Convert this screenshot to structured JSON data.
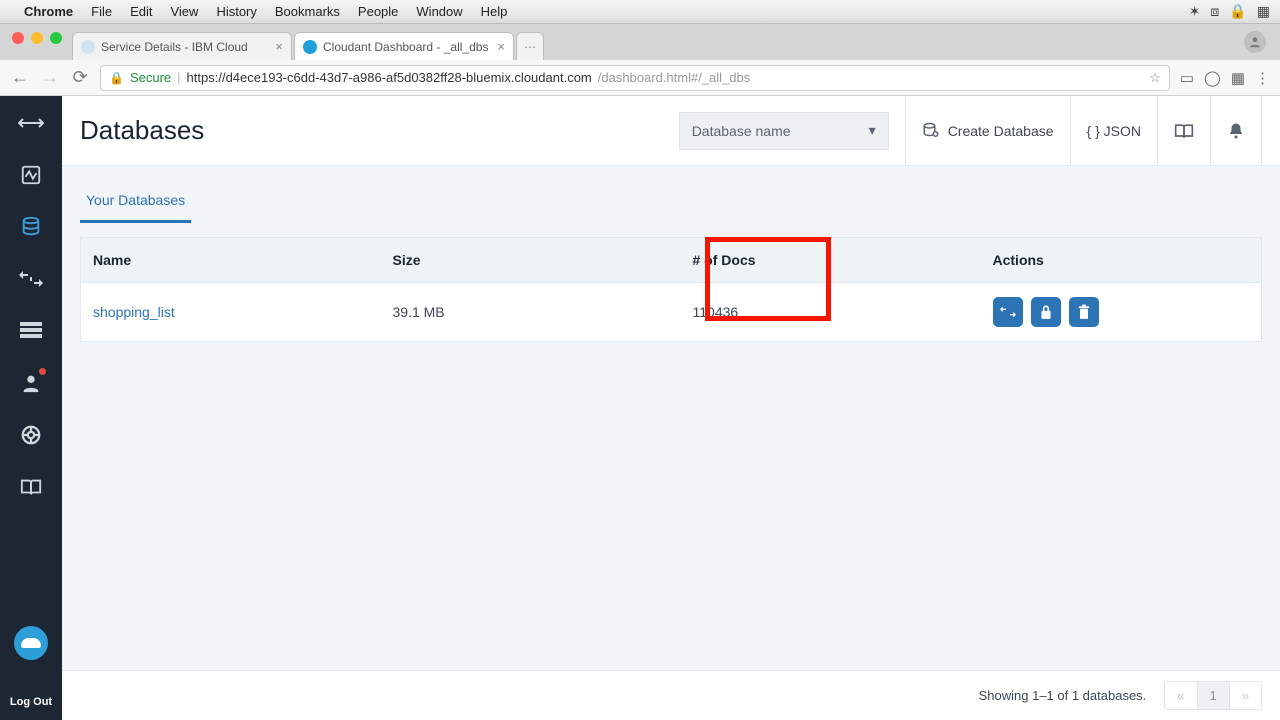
{
  "mac_menu": {
    "items": [
      "Chrome",
      "File",
      "Edit",
      "View",
      "History",
      "Bookmarks",
      "People",
      "Window",
      "Help"
    ]
  },
  "browser": {
    "tabs": [
      {
        "title": "Service Details - IBM Cloud"
      },
      {
        "title": "Cloudant Dashboard - _all_dbs"
      }
    ],
    "secure_label": "Secure",
    "url_host": "https://d4ece193-c6dd-43d7-a986-af5d0382ff28-bluemix.cloudant.com",
    "url_path": "/dashboard.html#/_all_dbs"
  },
  "leftnav": {
    "logout": "Log Out"
  },
  "header": {
    "title": "Databases",
    "db_select_placeholder": "Database name",
    "create_db": "Create Database",
    "json_label": "{ } JSON"
  },
  "tabs": {
    "your_databases": "Your Databases"
  },
  "table": {
    "columns": {
      "name": "Name",
      "size": "Size",
      "docs": "# of Docs",
      "actions": "Actions"
    },
    "rows": [
      {
        "name": "shopping_list",
        "size": "39.1 MB",
        "docs": "110436"
      }
    ]
  },
  "footer": {
    "status": "Showing 1–1 of 1 databases.",
    "prev": "«",
    "page": "1",
    "next": "»"
  }
}
